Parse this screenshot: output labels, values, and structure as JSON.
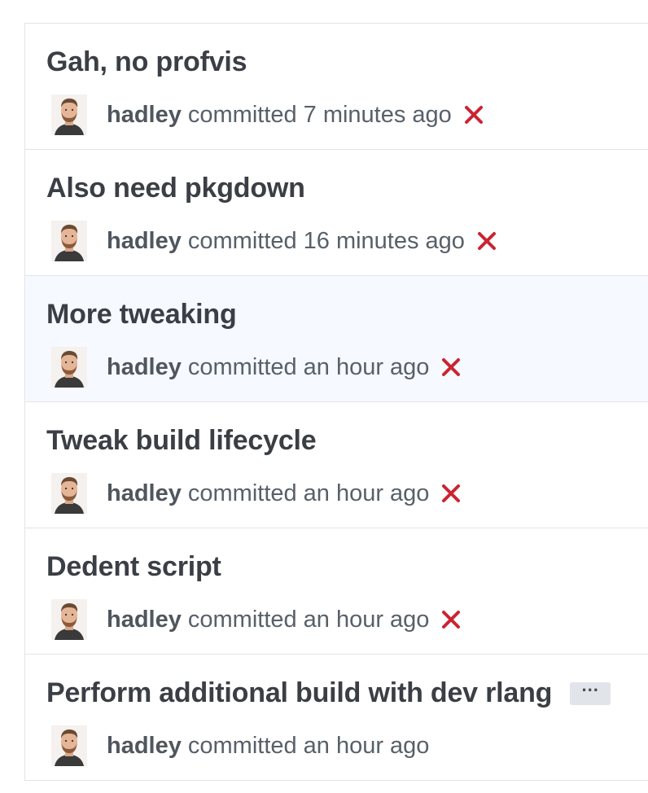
{
  "commits": [
    {
      "title": "Gah, no profvis",
      "author": "hadley",
      "verb": "committed",
      "time": "7 minutes ago",
      "status": "failure",
      "highlighted": false,
      "has_ellipsis": false
    },
    {
      "title": "Also need pkgdown",
      "author": "hadley",
      "verb": "committed",
      "time": "16 minutes ago",
      "status": "failure",
      "highlighted": false,
      "has_ellipsis": false
    },
    {
      "title": "More tweaking",
      "author": "hadley",
      "verb": "committed",
      "time": "an hour ago",
      "status": "failure",
      "highlighted": true,
      "has_ellipsis": false
    },
    {
      "title": "Tweak build lifecycle",
      "author": "hadley",
      "verb": "committed",
      "time": "an hour ago",
      "status": "failure",
      "highlighted": false,
      "has_ellipsis": false
    },
    {
      "title": "Dedent script",
      "author": "hadley",
      "verb": "committed",
      "time": "an hour ago",
      "status": "failure",
      "highlighted": false,
      "has_ellipsis": false
    },
    {
      "title": "Perform additional build with dev rlang",
      "author": "hadley",
      "verb": "committed",
      "time": "an hour ago",
      "status": "none",
      "highlighted": false,
      "has_ellipsis": true,
      "ellipsis_label": "···"
    }
  ],
  "colors": {
    "failure": "#cb2431",
    "highlight_bg": "#f6f9ff",
    "border": "#e1e4e8"
  },
  "icons": {
    "status_failure": "x-icon",
    "avatar": "avatar"
  }
}
